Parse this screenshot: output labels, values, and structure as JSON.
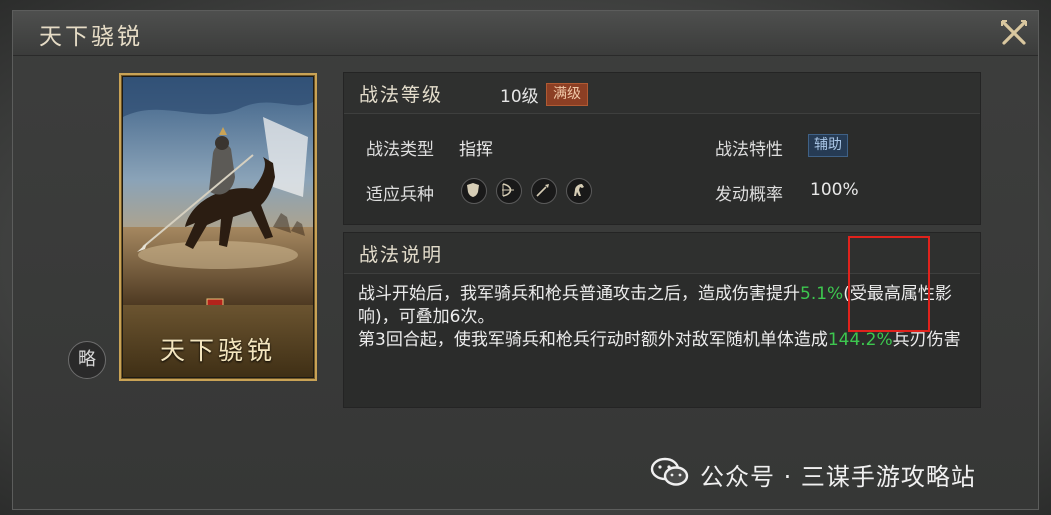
{
  "window": {
    "title": "天下骁锐"
  },
  "card": {
    "name": "天下骁锐"
  },
  "strategy_badge": "略",
  "level": {
    "label": "战法等级",
    "value": "10级",
    "tag": "满级"
  },
  "tactic_type": {
    "label": "战法类型",
    "value": "指挥"
  },
  "tactic_trait": {
    "label": "战法特性",
    "value": "辅助"
  },
  "troops": {
    "label": "适应兵种",
    "icons": [
      "shield-icon",
      "bow-icon",
      "spear-icon",
      "horse-icon"
    ]
  },
  "trigger": {
    "label": "发动概率",
    "value": "100%"
  },
  "description": {
    "label": "战法说明",
    "p1_a": "战斗开始后，我军骑兵和枪兵普通攻击之后，造成伤害提升",
    "p1_hl": "5.1%",
    "p1_b": "(受最高属性影响)，可叠加6次。",
    "p2_a": "第3回合起，使我军骑兵和枪兵行动时额外对敌军随机单体造成",
    "p2_hl": "144.2%",
    "p2_b": "兵刃伤害"
  },
  "watermark": {
    "text": "公众号 · 三谋手游攻略站"
  },
  "colors": {
    "highlight": "#3dc74f",
    "annotation": "#e0221c",
    "gold": "#c9a356"
  }
}
